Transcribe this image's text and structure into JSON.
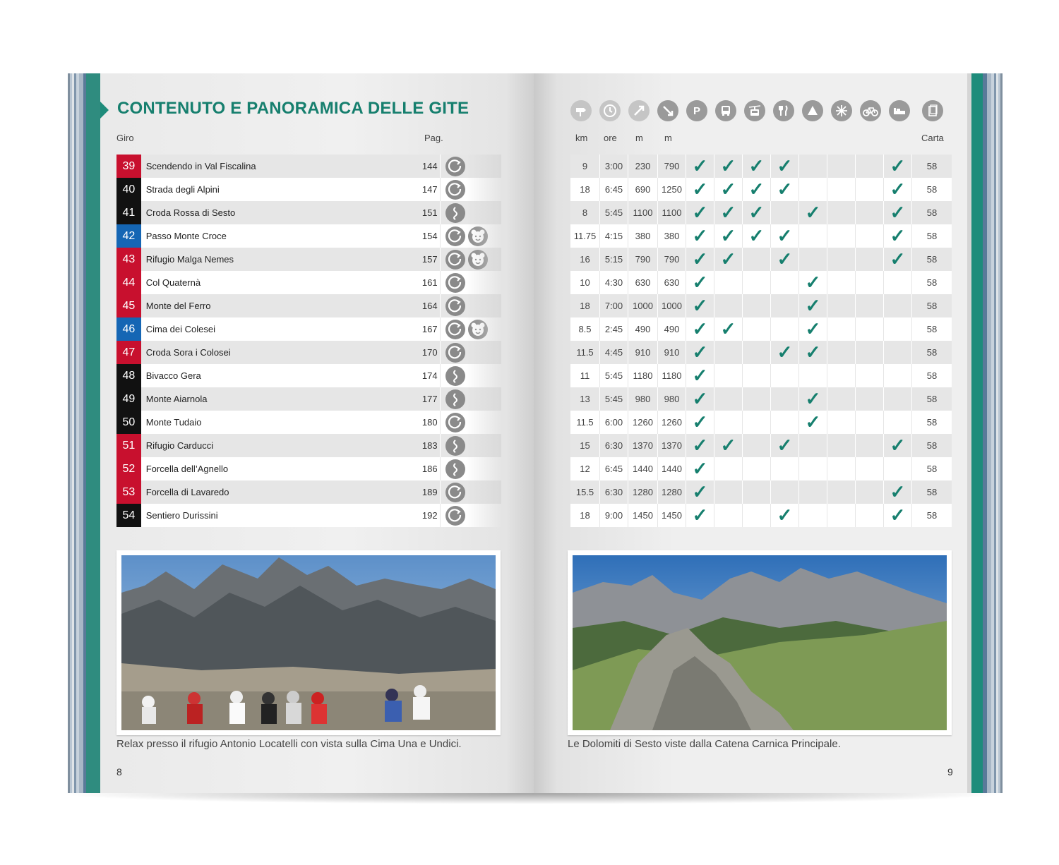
{
  "title": "CONTENUTO E PANORAMICA DELLE GITE",
  "headers": {
    "giro": "Giro",
    "pag": "Pag.",
    "km": "km",
    "ore": "ore",
    "m_up": "m",
    "m_down": "m",
    "carta": "Carta"
  },
  "header_icons": [
    "signpost-icon",
    "clock-icon",
    "ascent-icon",
    "descent-icon",
    "parking-icon",
    "bus-icon",
    "cable-car-icon",
    "restaurant-icon",
    "hut-icon",
    "winter-icon",
    "bike-icon",
    "overnight-icon",
    "map-icon"
  ],
  "colors": {
    "accent": "#167f6e",
    "red": "#c8102e",
    "black": "#111111",
    "blue": "#1566b4"
  },
  "tours": [
    {
      "num": "39",
      "color": "red",
      "name": "Scendendo in Val Fiscalina",
      "pag": "144",
      "route": "loop",
      "kids": false,
      "km": "9",
      "ore": "3:00",
      "m_up": "230",
      "m_down": "790",
      "checks": [
        1,
        1,
        1,
        1,
        0,
        0,
        0,
        1
      ],
      "carta": "58"
    },
    {
      "num": "40",
      "color": "black",
      "name": "Strada degli Alpini",
      "pag": "147",
      "route": "loop",
      "kids": false,
      "km": "18",
      "ore": "6:45",
      "m_up": "690",
      "m_down": "1250",
      "checks": [
        1,
        1,
        1,
        1,
        0,
        0,
        0,
        1
      ],
      "carta": "58"
    },
    {
      "num": "41",
      "color": "black",
      "name": "Croda Rossa di Sesto",
      "pag": "151",
      "route": "winding",
      "kids": false,
      "km": "8",
      "ore": "5:45",
      "m_up": "1100",
      "m_down": "1100",
      "checks": [
        1,
        1,
        1,
        0,
        1,
        0,
        0,
        1
      ],
      "carta": "58"
    },
    {
      "num": "42",
      "color": "blue",
      "name": "Passo Monte Croce",
      "pag": "154",
      "route": "loop",
      "kids": true,
      "km": "11.75",
      "ore": "4:15",
      "m_up": "380",
      "m_down": "380",
      "checks": [
        1,
        1,
        1,
        1,
        0,
        0,
        0,
        1
      ],
      "carta": "58"
    },
    {
      "num": "43",
      "color": "red",
      "name": "Rifugio Malga Nemes",
      "pag": "157",
      "route": "loop",
      "kids": true,
      "km": "16",
      "ore": "5:15",
      "m_up": "790",
      "m_down": "790",
      "checks": [
        1,
        1,
        0,
        1,
        0,
        0,
        0,
        1
      ],
      "carta": "58"
    },
    {
      "num": "44",
      "color": "red",
      "name": "Col Quaternà",
      "pag": "161",
      "route": "loop",
      "kids": false,
      "km": "10",
      "ore": "4:30",
      "m_up": "630",
      "m_down": "630",
      "checks": [
        1,
        0,
        0,
        0,
        1,
        0,
        0,
        0
      ],
      "carta": "58"
    },
    {
      "num": "45",
      "color": "red",
      "name": "Monte del Ferro",
      "pag": "164",
      "route": "loop",
      "kids": false,
      "km": "18",
      "ore": "7:00",
      "m_up": "1000",
      "m_down": "1000",
      "checks": [
        1,
        0,
        0,
        0,
        1,
        0,
        0,
        0
      ],
      "carta": "58"
    },
    {
      "num": "46",
      "color": "blue",
      "name": "Cima dei Colesei",
      "pag": "167",
      "route": "loop",
      "kids": true,
      "km": "8.5",
      "ore": "2:45",
      "m_up": "490",
      "m_down": "490",
      "checks": [
        1,
        1,
        0,
        0,
        1,
        0,
        0,
        0
      ],
      "carta": "58"
    },
    {
      "num": "47",
      "color": "red",
      "name": "Croda Sora i Colosei",
      "pag": "170",
      "route": "loop",
      "kids": false,
      "km": "11.5",
      "ore": "4:45",
      "m_up": "910",
      "m_down": "910",
      "checks": [
        1,
        0,
        0,
        1,
        1,
        0,
        0,
        0
      ],
      "carta": "58"
    },
    {
      "num": "48",
      "color": "black",
      "name": "Bivacco Gera",
      "pag": "174",
      "route": "winding",
      "kids": false,
      "km": "11",
      "ore": "5:45",
      "m_up": "1180",
      "m_down": "1180",
      "checks": [
        1,
        0,
        0,
        0,
        0,
        0,
        0,
        0
      ],
      "carta": "58"
    },
    {
      "num": "49",
      "color": "black",
      "name": "Monte Aiarnola",
      "pag": "177",
      "route": "winding",
      "kids": false,
      "km": "13",
      "ore": "5:45",
      "m_up": "980",
      "m_down": "980",
      "checks": [
        1,
        0,
        0,
        0,
        1,
        0,
        0,
        0
      ],
      "carta": "58"
    },
    {
      "num": "50",
      "color": "black",
      "name": "Monte Tudaio",
      "pag": "180",
      "route": "loop",
      "kids": false,
      "km": "11.5",
      "ore": "6:00",
      "m_up": "1260",
      "m_down": "1260",
      "checks": [
        1,
        0,
        0,
        0,
        1,
        0,
        0,
        0
      ],
      "carta": "58"
    },
    {
      "num": "51",
      "color": "red",
      "name": "Rifugio Carducci",
      "pag": "183",
      "route": "winding",
      "kids": false,
      "km": "15",
      "ore": "6:30",
      "m_up": "1370",
      "m_down": "1370",
      "checks": [
        1,
        1,
        0,
        1,
        0,
        0,
        0,
        1
      ],
      "carta": "58"
    },
    {
      "num": "52",
      "color": "red",
      "name": "Forcella dell’Agnello",
      "pag": "186",
      "route": "winding",
      "kids": false,
      "km": "12",
      "ore": "6:45",
      "m_up": "1440",
      "m_down": "1440",
      "checks": [
        1,
        0,
        0,
        0,
        0,
        0,
        0,
        0
      ],
      "carta": "58"
    },
    {
      "num": "53",
      "color": "red",
      "name": "Forcella di Lavaredo",
      "pag": "189",
      "route": "loop",
      "kids": false,
      "km": "15.5",
      "ore": "6:30",
      "m_up": "1280",
      "m_down": "1280",
      "checks": [
        1,
        0,
        0,
        0,
        0,
        0,
        0,
        1
      ],
      "carta": "58"
    },
    {
      "num": "54",
      "color": "black",
      "name": "Sentiero Durissini",
      "pag": "192",
      "route": "loop",
      "kids": false,
      "km": "18",
      "ore": "9:00",
      "m_up": "1450",
      "m_down": "1450",
      "checks": [
        1,
        0,
        0,
        1,
        0,
        0,
        0,
        1
      ],
      "carta": "58"
    }
  ],
  "captions": {
    "left": "Relax presso il rifugio Antonio Locatelli con vista sulla Cima Una e Undici.",
    "right": "Le Dolomiti di Sesto viste dalla Catena Carnica Principale."
  },
  "page_numbers": {
    "left": "8",
    "right": "9"
  },
  "check_glyph": "✓"
}
